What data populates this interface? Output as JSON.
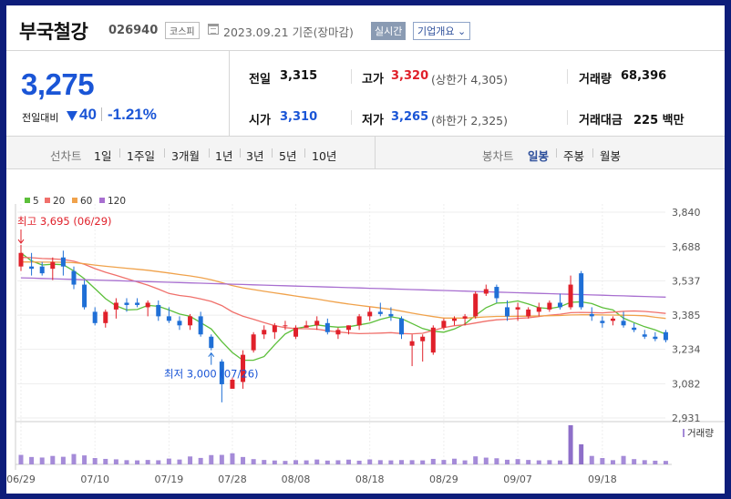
{
  "header": {
    "stock_name": "부국철강",
    "stock_code": "026940",
    "market": "코스피",
    "date": "2023.09.21",
    "date_suffix": "기준(장마감)",
    "realtime": "실시간",
    "company_info": "기업개요"
  },
  "summary": {
    "price": "3,275",
    "diff_label": "전일대비",
    "diff": "40",
    "diff_rate": "-1.21%",
    "prev_close_label": "전일",
    "prev_close": "3,315",
    "high_label": "고가",
    "high": "3,320",
    "upper_limit": "(상한가 4,305)",
    "volume_label": "거래량",
    "volume": "68,396",
    "open_label": "시가",
    "open": "3,310",
    "low_label": "저가",
    "low": "3,265",
    "lower_limit": "(하한가 2,325)",
    "amount_label": "거래대금",
    "amount": "225 백만"
  },
  "period": {
    "line_chart_label": "선차트",
    "line_items": [
      "1일",
      "1주일",
      "3개월",
      "1년",
      "3년",
      "5년",
      "10년"
    ],
    "candle_chart_label": "봉차트",
    "candle_items": [
      "일봉",
      "주봉",
      "월봉"
    ],
    "candle_selected": "일봉"
  },
  "colors": {
    "up": "#e0202a",
    "down": "#1f6fd6",
    "ma5": "#5cbf3a",
    "ma20": "#f0706b",
    "ma60": "#f0a24b",
    "ma120": "#a86fd0",
    "volume": "#a58bd8",
    "volume_hi": "#8e6fc9"
  },
  "chart_data": {
    "type": "candlestick",
    "legend": [
      "5",
      "20",
      "60",
      "120"
    ],
    "y_ticks": [
      3840,
      3688,
      3537,
      3385,
      3234,
      3082,
      2931
    ],
    "y_tick_labels": [
      "3,840",
      "3,688",
      "3,537",
      "3,385",
      "3,234",
      "3,082",
      "2,931"
    ],
    "ylim": [
      2931,
      3840
    ],
    "x_labels": [
      {
        "i": 0,
        "label": "06/29"
      },
      {
        "i": 7,
        "label": "07/10"
      },
      {
        "i": 14,
        "label": "07/19"
      },
      {
        "i": 20,
        "label": "07/28"
      },
      {
        "i": 26,
        "label": "08/08"
      },
      {
        "i": 33,
        "label": "08/18"
      },
      {
        "i": 40,
        "label": "08/29"
      },
      {
        "i": 47,
        "label": "09/07"
      },
      {
        "i": 55,
        "label": "09/18"
      }
    ],
    "annotation_high": {
      "label": "최고",
      "value": "3,695",
      "date": "(06/29)",
      "i": 0
    },
    "annotation_low": {
      "label": "최저",
      "value": "3,000",
      "date": "(07/26)",
      "i": 18
    },
    "volume_label": "거래량",
    "candles": [
      [
        3600,
        3695,
        3580,
        3660,
        9000
      ],
      [
        3600,
        3660,
        3560,
        3590,
        7000
      ],
      [
        3600,
        3620,
        3560,
        3570,
        6500
      ],
      [
        3590,
        3640,
        3540,
        3620,
        8000
      ],
      [
        3640,
        3670,
        3560,
        3600,
        7200
      ],
      [
        3580,
        3600,
        3500,
        3520,
        9800
      ],
      [
        3520,
        3540,
        3410,
        3420,
        8500
      ],
      [
        3400,
        3420,
        3340,
        3350,
        6000
      ],
      [
        3350,
        3410,
        3330,
        3400,
        5200
      ],
      [
        3410,
        3460,
        3370,
        3440,
        4800
      ],
      [
        3440,
        3460,
        3400,
        3430,
        4000
      ],
      [
        3440,
        3460,
        3420,
        3430,
        3800
      ],
      [
        3420,
        3450,
        3380,
        3440,
        4200
      ],
      [
        3430,
        3450,
        3360,
        3380,
        3900
      ],
      [
        3380,
        3420,
        3350,
        3360,
        5500
      ],
      [
        3360,
        3380,
        3320,
        3340,
        4600
      ],
      [
        3340,
        3390,
        3320,
        3380,
        7500
      ],
      [
        3380,
        3400,
        3290,
        3300,
        6100
      ],
      [
        3290,
        3300,
        3230,
        3240,
        8800
      ],
      [
        3180,
        3190,
        3000,
        3080,
        9000
      ],
      [
        3060,
        3110,
        3060,
        3100,
        10500
      ],
      [
        3090,
        3230,
        3060,
        3210,
        7000
      ],
      [
        3230,
        3310,
        3220,
        3300,
        5000
      ],
      [
        3300,
        3340,
        3280,
        3320,
        4200
      ],
      [
        3310,
        3350,
        3280,
        3340,
        3700
      ],
      [
        3340,
        3360,
        3320,
        3340,
        3300
      ],
      [
        3290,
        3340,
        3280,
        3330,
        4000
      ],
      [
        3330,
        3360,
        3330,
        3340,
        3800
      ],
      [
        3340,
        3380,
        3320,
        3360,
        4600
      ],
      [
        3350,
        3370,
        3300,
        3310,
        3600
      ],
      [
        3300,
        3330,
        3280,
        3320,
        3900
      ],
      [
        3320,
        3340,
        3300,
        3340,
        4500
      ],
      [
        3340,
        3390,
        3320,
        3380,
        3500
      ],
      [
        3380,
        3420,
        3360,
        3400,
        4700
      ],
      [
        3400,
        3440,
        3380,
        3390,
        4000
      ],
      [
        3390,
        3420,
        3360,
        3380,
        3800
      ],
      [
        3370,
        3380,
        3280,
        3300,
        4100
      ],
      [
        3250,
        3300,
        3160,
        3270,
        4000
      ],
      [
        3270,
        3300,
        3180,
        3290,
        3800
      ],
      [
        3220,
        3340,
        3210,
        3330,
        5200
      ],
      [
        3330,
        3370,
        3320,
        3360,
        4200
      ],
      [
        3360,
        3380,
        3340,
        3370,
        5400
      ],
      [
        3370,
        3390,
        3340,
        3380,
        3800
      ],
      [
        3380,
        3490,
        3370,
        3480,
        7600
      ],
      [
        3480,
        3520,
        3470,
        3500,
        6400
      ],
      [
        3510,
        3520,
        3440,
        3460,
        5800
      ],
      [
        3420,
        3450,
        3360,
        3380,
        4400
      ],
      [
        3410,
        3440,
        3360,
        3420,
        5000
      ],
      [
        3380,
        3420,
        3370,
        3410,
        4200
      ],
      [
        3400,
        3440,
        3380,
        3420,
        3800
      ],
      [
        3410,
        3450,
        3400,
        3440,
        4000
      ],
      [
        3440,
        3480,
        3410,
        3420,
        3700
      ],
      [
        3420,
        3560,
        3410,
        3520,
        37000
      ],
      [
        3570,
        3580,
        3410,
        3420,
        19000
      ],
      [
        3390,
        3420,
        3360,
        3380,
        8000
      ],
      [
        3360,
        3380,
        3330,
        3350,
        6000
      ],
      [
        3360,
        3380,
        3340,
        3370,
        4000
      ],
      [
        3360,
        3400,
        3330,
        3340,
        8000
      ],
      [
        3330,
        3350,
        3310,
        3320,
        5000
      ],
      [
        3300,
        3320,
        3280,
        3290,
        4000
      ],
      [
        3290,
        3310,
        3270,
        3280,
        3500
      ],
      [
        3310,
        3320,
        3265,
        3275,
        3300
      ]
    ]
  }
}
